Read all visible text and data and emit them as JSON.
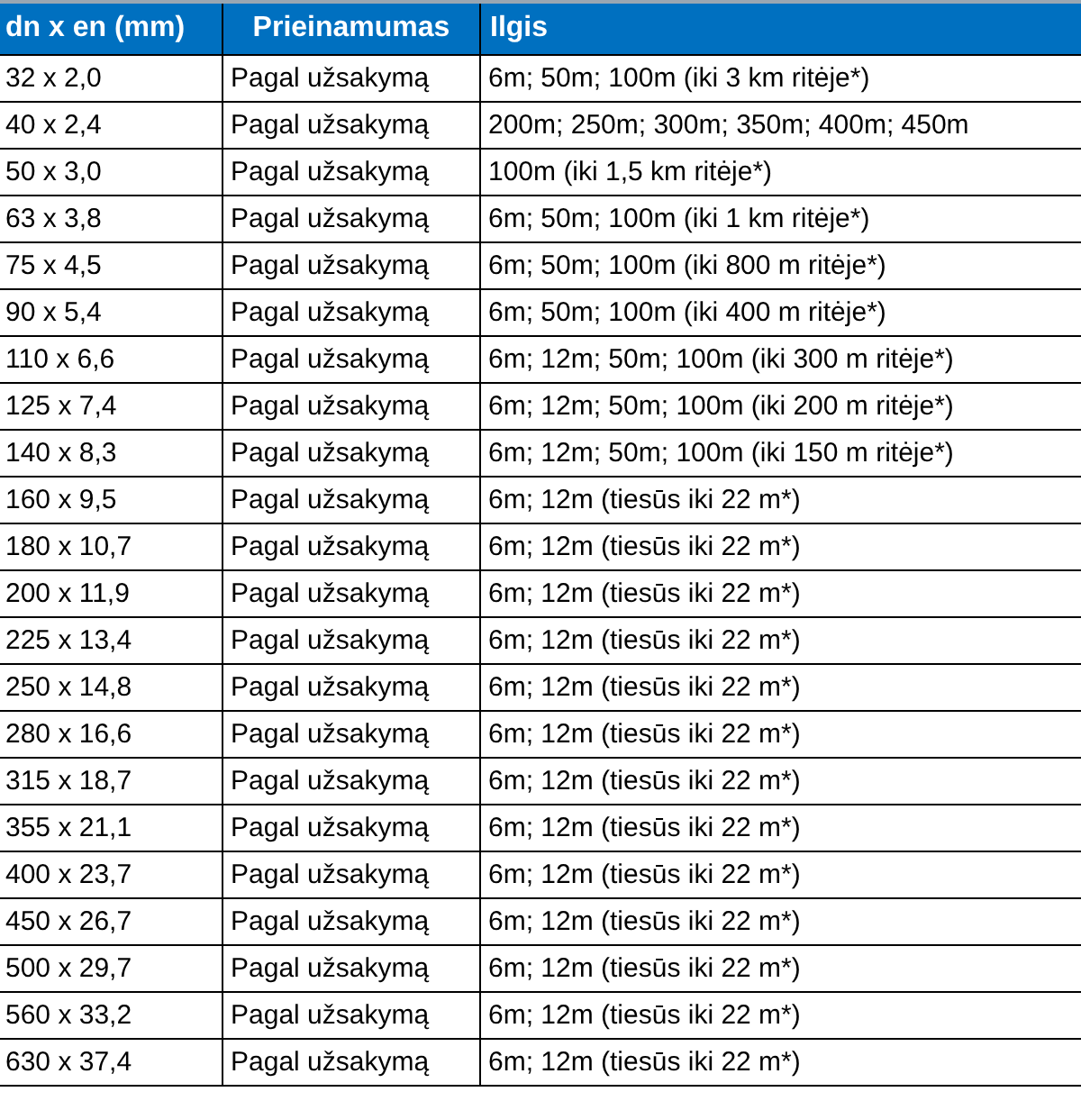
{
  "table": {
    "columns": [
      "dn x en (mm)",
      "Prieinamumas",
      "Ilgis"
    ],
    "rows": [
      [
        "32 x 2,0",
        "Pagal užsakymą",
        "6m; 50m; 100m (iki 3 km ritėje*)"
      ],
      [
        "40 x 2,4",
        "Pagal užsakymą",
        "200m; 250m; 300m; 350m; 400m; 450m"
      ],
      [
        "50 x 3,0",
        "Pagal užsakymą",
        "100m (iki 1,5 km ritėje*)"
      ],
      [
        "63 x 3,8",
        "Pagal užsakymą",
        "6m; 50m; 100m (iki 1 km ritėje*)"
      ],
      [
        "75 x 4,5",
        "Pagal užsakymą",
        "6m; 50m; 100m (iki 800 m ritėje*)"
      ],
      [
        "90 x 5,4",
        "Pagal užsakymą",
        "6m; 50m; 100m (iki 400 m ritėje*)"
      ],
      [
        "110 x 6,6",
        "Pagal užsakymą",
        "6m; 12m; 50m; 100m (iki 300 m ritėje*)"
      ],
      [
        "125 x 7,4",
        "Pagal užsakymą",
        "6m; 12m; 50m; 100m (iki 200 m ritėje*)"
      ],
      [
        "140 x 8,3",
        "Pagal užsakymą",
        "6m; 12m; 50m; 100m (iki 150 m ritėje*)"
      ],
      [
        "160 x 9,5",
        "Pagal užsakymą",
        "6m; 12m (tiesūs iki 22 m*)"
      ],
      [
        "180 x 10,7",
        "Pagal užsakymą",
        "6m; 12m (tiesūs iki 22 m*)"
      ],
      [
        "200 x 11,9",
        "Pagal užsakymą",
        "6m; 12m (tiesūs iki 22 m*)"
      ],
      [
        "225 x 13,4",
        "Pagal užsakymą",
        "6m; 12m (tiesūs iki 22 m*)"
      ],
      [
        "250 x 14,8",
        "Pagal užsakymą",
        "6m; 12m (tiesūs iki 22 m*)"
      ],
      [
        "280 x 16,6",
        "Pagal užsakymą",
        "6m; 12m (tiesūs iki 22 m*)"
      ],
      [
        "315 x 18,7",
        "Pagal užsakymą",
        "6m; 12m (tiesūs iki 22 m*)"
      ],
      [
        "355 x 21,1",
        "Pagal užsakymą",
        "6m; 12m (tiesūs iki 22 m*)"
      ],
      [
        "400 x 23,7",
        "Pagal užsakymą",
        "6m; 12m (tiesūs iki 22 m*)"
      ],
      [
        "450 x 26,7",
        "Pagal užsakymą",
        "6m; 12m (tiesūs iki 22 m*)"
      ],
      [
        "500 x 29,7",
        "Pagal užsakymą",
        "6m; 12m (tiesūs iki 22 m*)"
      ],
      [
        "560 x 33,2",
        "Pagal užsakymą",
        "6m; 12m (tiesūs iki 22 m*)"
      ],
      [
        "630 x 37,4",
        "Pagal užsakymą",
        "6m; 12m (tiesūs iki 22 m*)"
      ]
    ]
  }
}
